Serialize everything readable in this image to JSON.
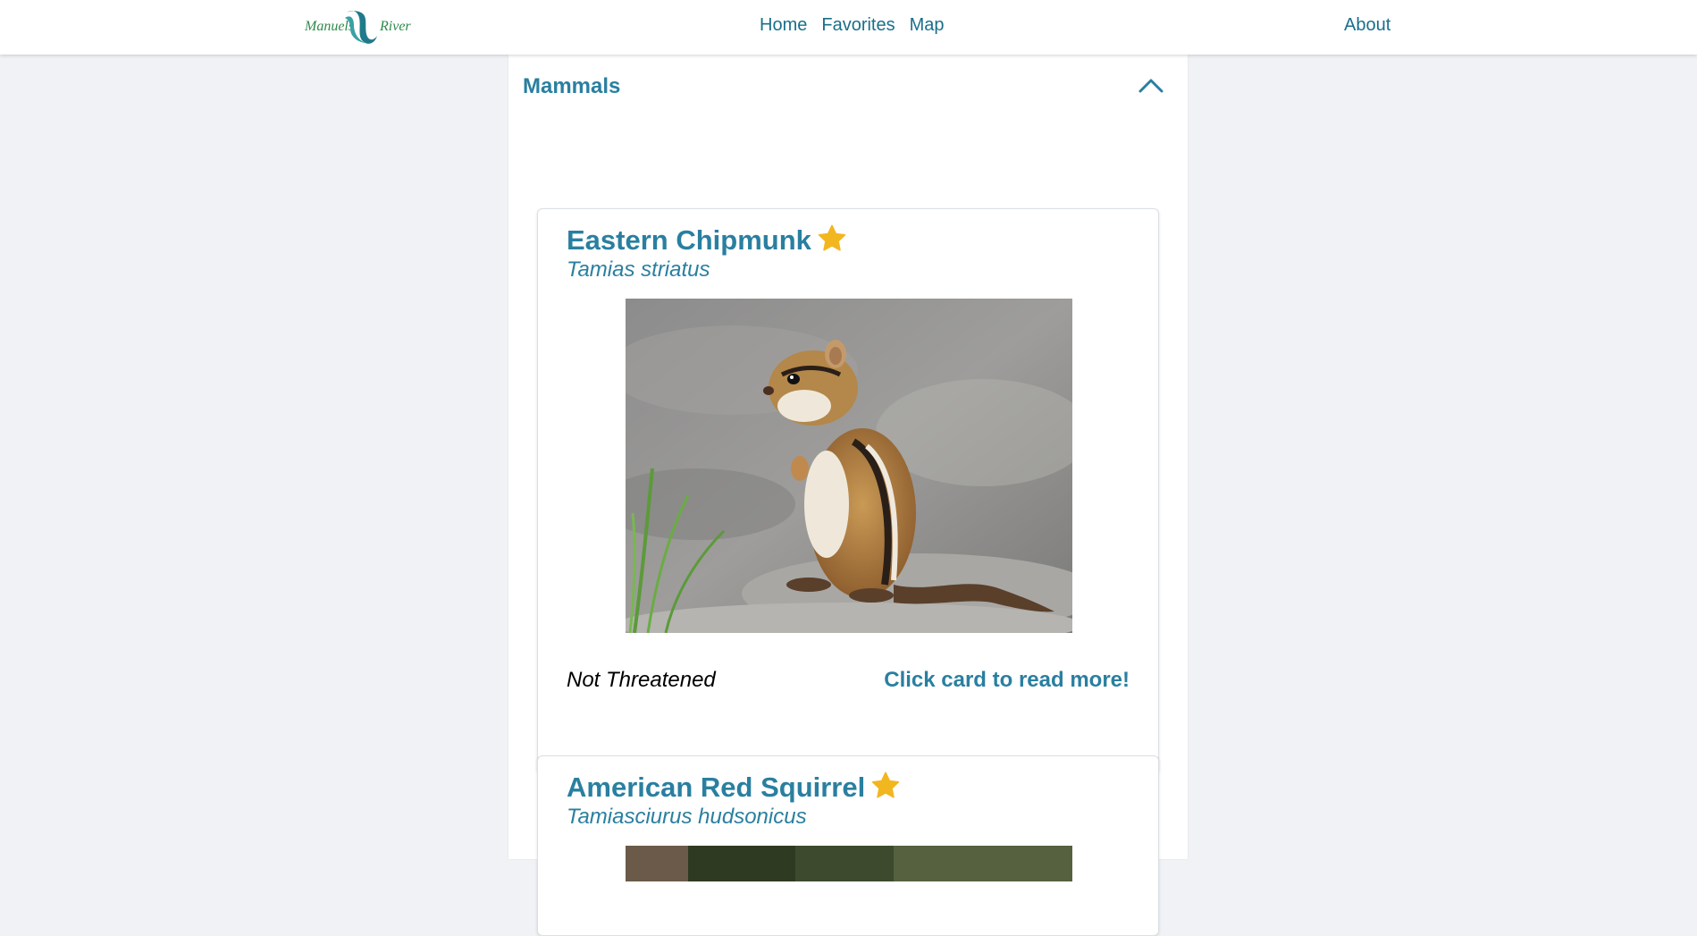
{
  "logo": {
    "text_left": "Manuels",
    "text_right": "River"
  },
  "nav": {
    "links": [
      "Home",
      "Favorites",
      "Map"
    ],
    "about": "About"
  },
  "section": {
    "title": "Mammals",
    "expanded": true
  },
  "cards": [
    {
      "name": "Eastern Chipmunk",
      "scientific_name": "Tamias striatus",
      "favorite": true,
      "status": "Not Threatened",
      "more_label": "Click card to read more!",
      "photo": "chipmunk-photo"
    },
    {
      "name": "American Red Squirrel",
      "scientific_name": "Tamiasciurus hudsonicus",
      "favorite": true,
      "photo": "red-squirrel-photo"
    }
  ],
  "colors": {
    "accent": "#2a7fa0",
    "nav_text": "#1a6f8c",
    "logo_green": "#2f8a4c",
    "star": "#f2b61f",
    "page_bg": "#f0f2f5"
  }
}
